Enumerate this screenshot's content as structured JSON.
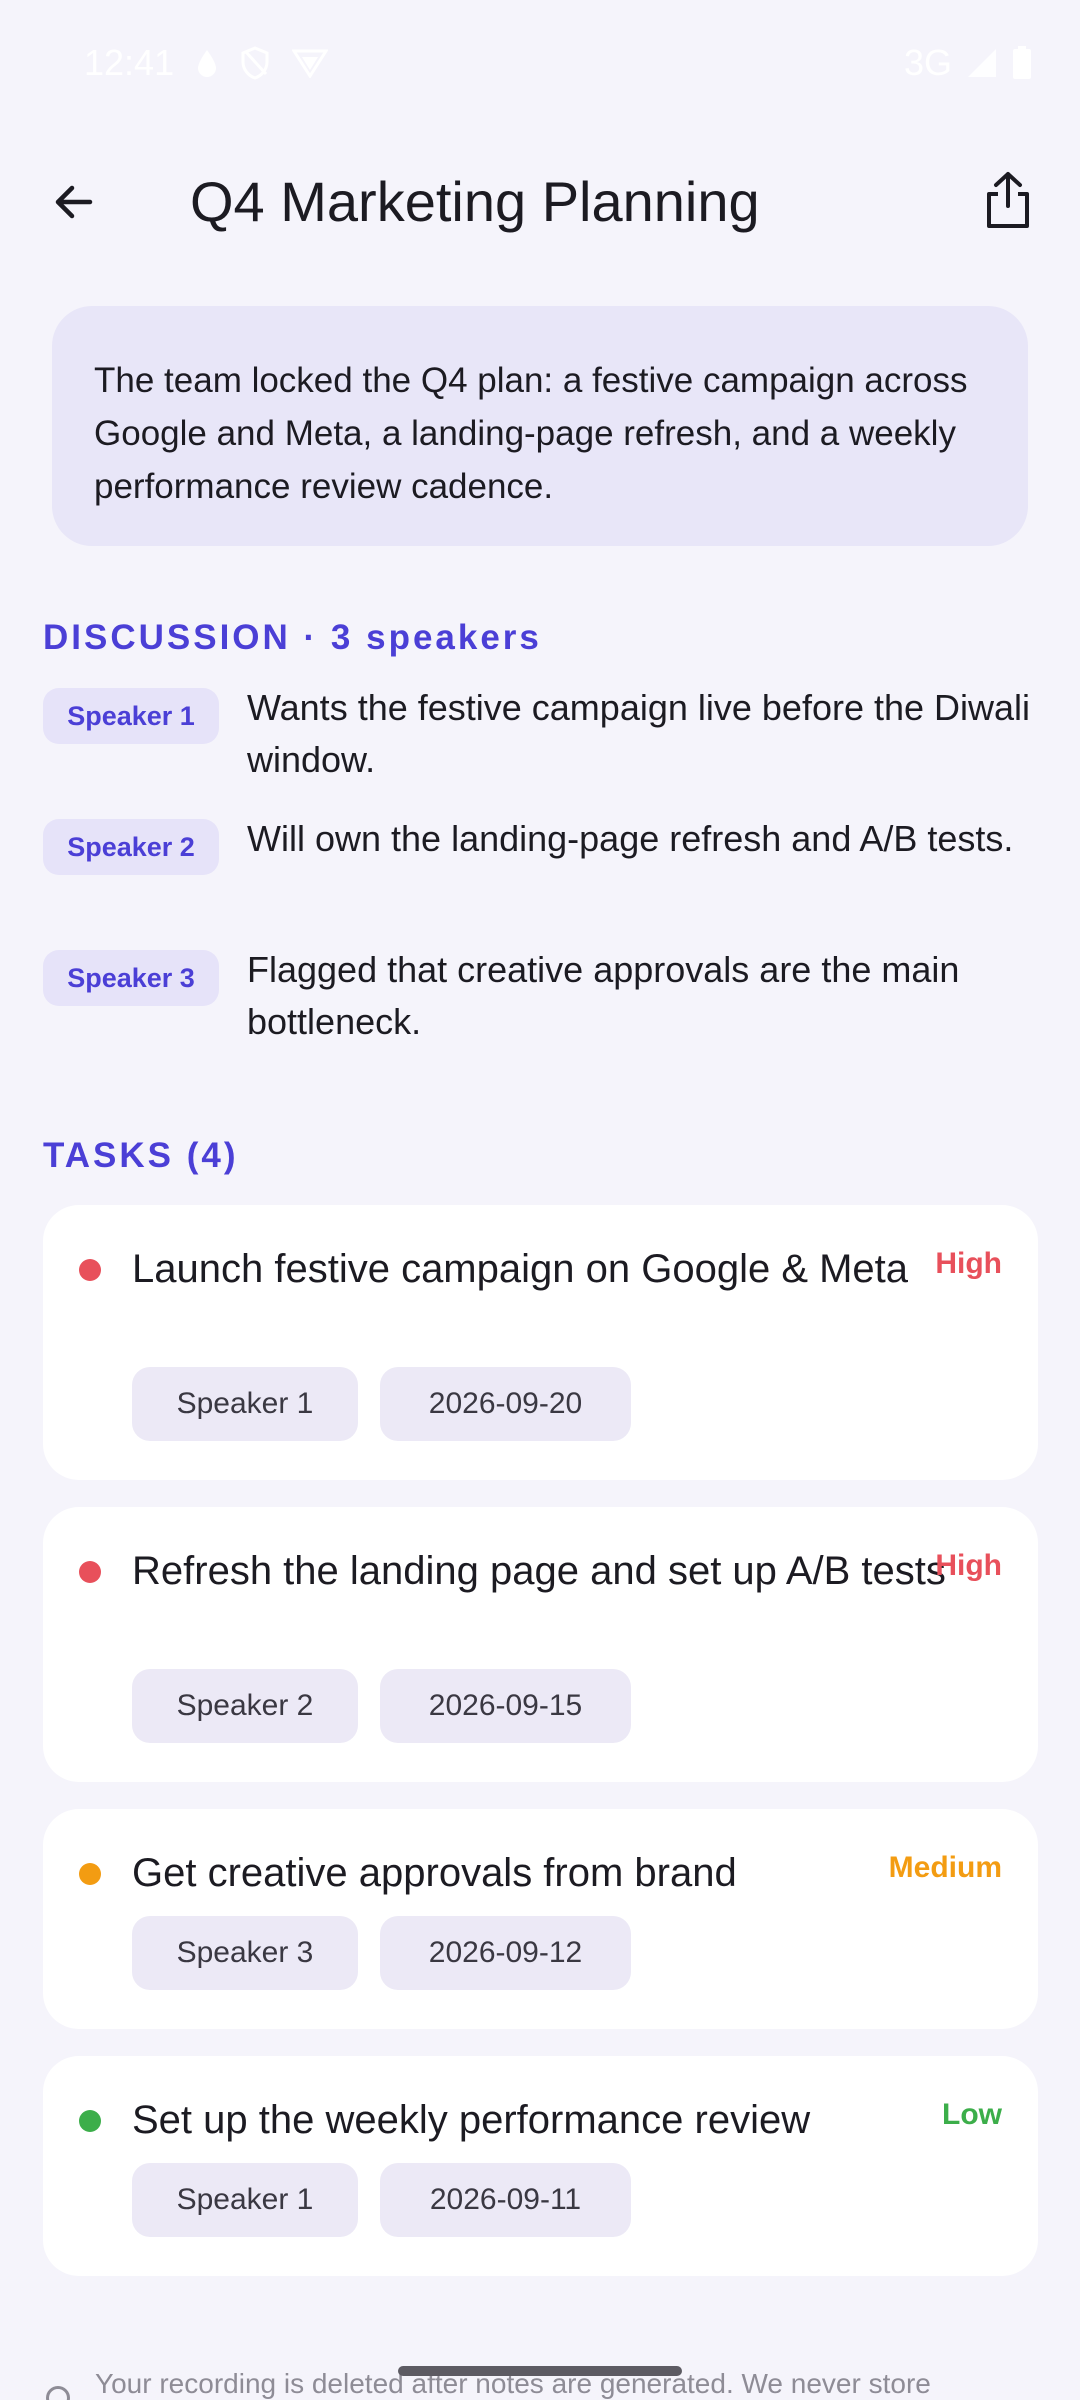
{
  "status_bar": {
    "time": "12:41",
    "network": "3G",
    "icons": [
      "drop-icon",
      "shield-icon",
      "vpn-icon",
      "signal-icon",
      "battery-icon"
    ]
  },
  "header": {
    "title": "Q4 Marketing Planning",
    "back_icon": "arrow-left-icon",
    "share_icon": "share-icon"
  },
  "summary": {
    "text": "The team locked the Q4 plan: a festive campaign across Google and Meta, a landing-page refresh, and a weekly performance review cadence."
  },
  "discussion": {
    "heading": "DISCUSSION · 3 speakers",
    "items": [
      {
        "speaker": "Speaker 1",
        "text": "Wants the festive campaign live before the Diwali window."
      },
      {
        "speaker": "Speaker 2",
        "text": "Will own the landing-page refresh and A/B tests."
      },
      {
        "speaker": "Speaker 3",
        "text": "Flagged that creative approvals are the main bottleneck."
      }
    ]
  },
  "tasks": {
    "heading": "TASKS (4)",
    "items": [
      {
        "title": "Launch festive campaign on Google & Meta",
        "priority": "High",
        "priority_color": "#e8505b",
        "speaker": "Speaker 1",
        "date": "2026-09-20"
      },
      {
        "title": "Refresh the landing page and set up A/B tests",
        "priority": "High",
        "priority_color": "#e8505b",
        "speaker": "Speaker 2",
        "date": "2026-09-15"
      },
      {
        "title": "Get creative approvals from brand",
        "priority": "Medium",
        "priority_color": "#f39c12",
        "speaker": "Speaker 3",
        "date": "2026-09-12"
      },
      {
        "title": "Set up the weekly performance review",
        "priority": "Low",
        "priority_color": "#3cae4a",
        "speaker": "Speaker 1",
        "date": "2026-09-11"
      }
    ]
  },
  "footer": {
    "note": "Your recording is deleted after notes are generated. We never store"
  },
  "colors": {
    "accent": "#4b3fd6",
    "background": "#f5f4fb",
    "summary_bg": "#e8e6f8"
  }
}
